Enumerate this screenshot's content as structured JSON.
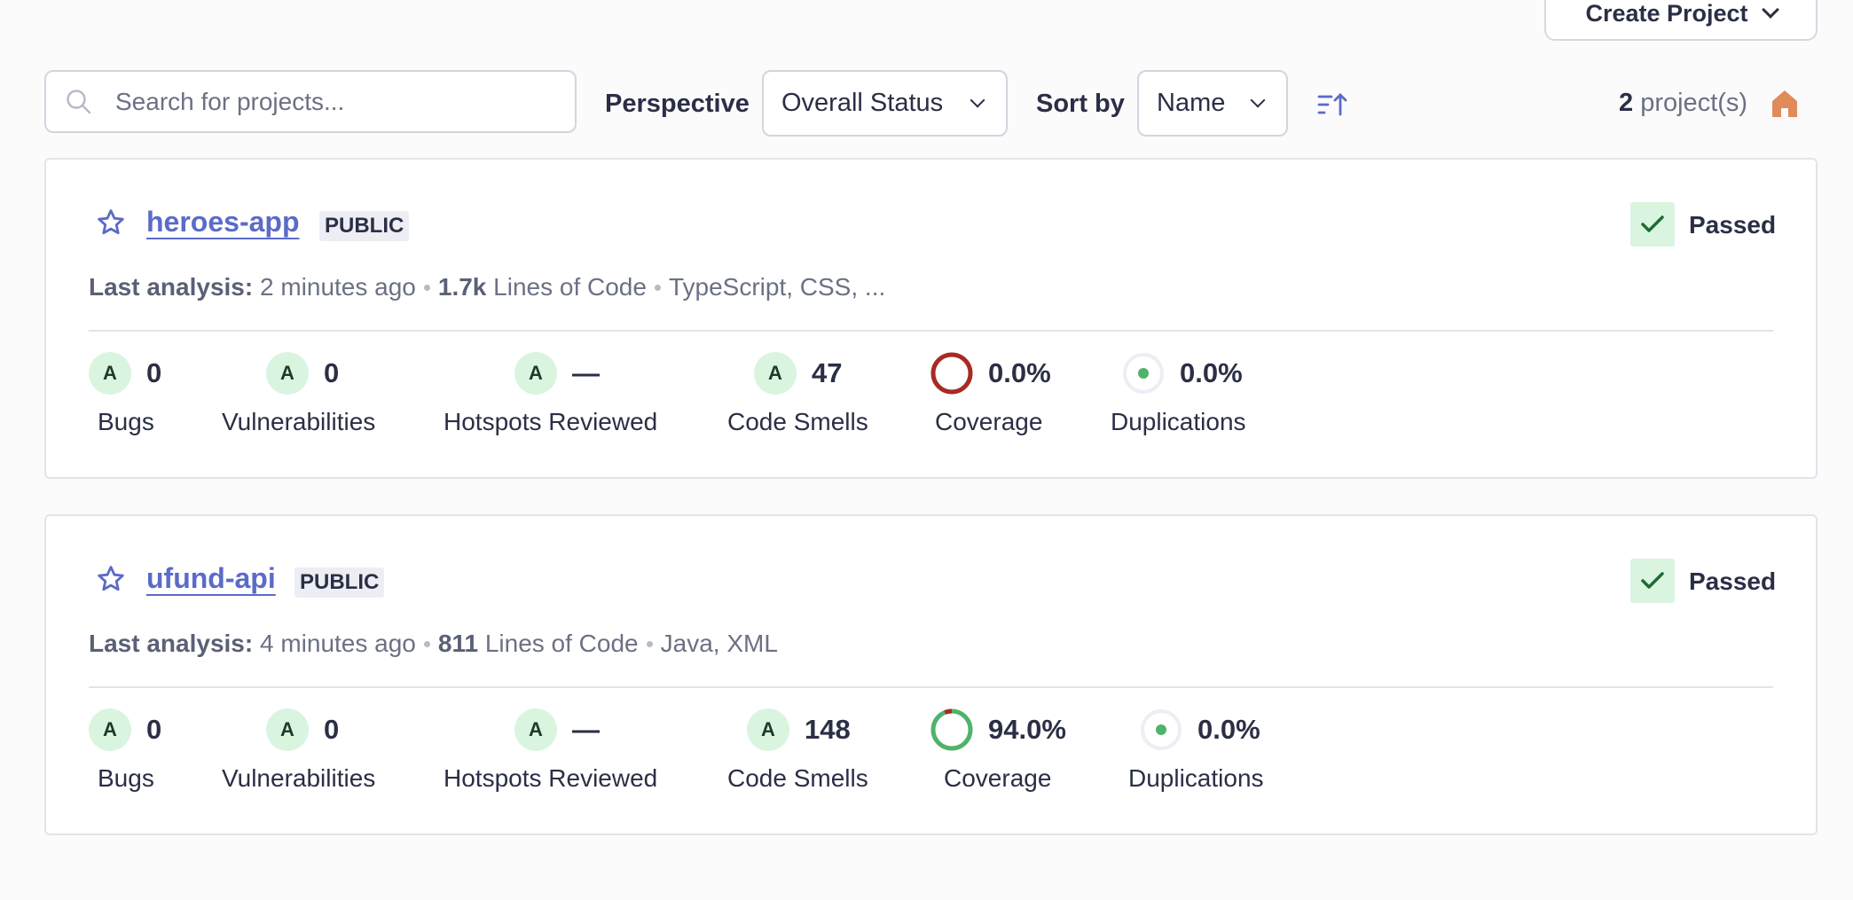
{
  "header": {
    "create_project_label": "Create Project"
  },
  "filters": {
    "search_placeholder": "Search for projects...",
    "perspective_label": "Perspective",
    "perspective_value": "Overall Status",
    "sort_label": "Sort by",
    "sort_value": "Name",
    "project_count": "2",
    "project_count_suffix": "project(s)"
  },
  "colors": {
    "link": "#5b6bc8",
    "passed_bg": "#d9f5df",
    "passed_check": "#1f6b34",
    "rating_bg": "#d9f5df",
    "coverage_bad": "#a82b22",
    "coverage_good": "#4fb36a",
    "home_icon": "#e08c5a"
  },
  "projects": [
    {
      "name": "heroes-app",
      "visibility": "PUBLIC",
      "status": "Passed",
      "last_analysis_label": "Last analysis:",
      "last_analysis_value": "2 minutes ago",
      "loc_value": "1.7k",
      "loc_label": "Lines of Code",
      "languages": "TypeScript, CSS, ...",
      "metrics": {
        "bugs": {
          "rating": "A",
          "value": "0",
          "label": "Bugs"
        },
        "vulnerabilities": {
          "rating": "A",
          "value": "0",
          "label": "Vulnerabilities"
        },
        "hotspots": {
          "rating": "A",
          "value": "—",
          "label": "Hotspots Reviewed"
        },
        "code_smells": {
          "rating": "A",
          "value": "47",
          "label": "Code Smells"
        },
        "coverage": {
          "value": "0.0%",
          "label": "Coverage",
          "fraction": 0.0
        },
        "duplications": {
          "value": "0.0%",
          "label": "Duplications"
        }
      }
    },
    {
      "name": "ufund-api",
      "visibility": "PUBLIC",
      "status": "Passed",
      "last_analysis_label": "Last analysis:",
      "last_analysis_value": "4 minutes ago",
      "loc_value": "811",
      "loc_label": "Lines of Code",
      "languages": "Java, XML",
      "metrics": {
        "bugs": {
          "rating": "A",
          "value": "0",
          "label": "Bugs"
        },
        "vulnerabilities": {
          "rating": "A",
          "value": "0",
          "label": "Vulnerabilities"
        },
        "hotspots": {
          "rating": "A",
          "value": "—",
          "label": "Hotspots Reviewed"
        },
        "code_smells": {
          "rating": "A",
          "value": "148",
          "label": "Code Smells"
        },
        "coverage": {
          "value": "94.0%",
          "label": "Coverage",
          "fraction": 0.94
        },
        "duplications": {
          "value": "0.0%",
          "label": "Duplications"
        }
      }
    }
  ]
}
